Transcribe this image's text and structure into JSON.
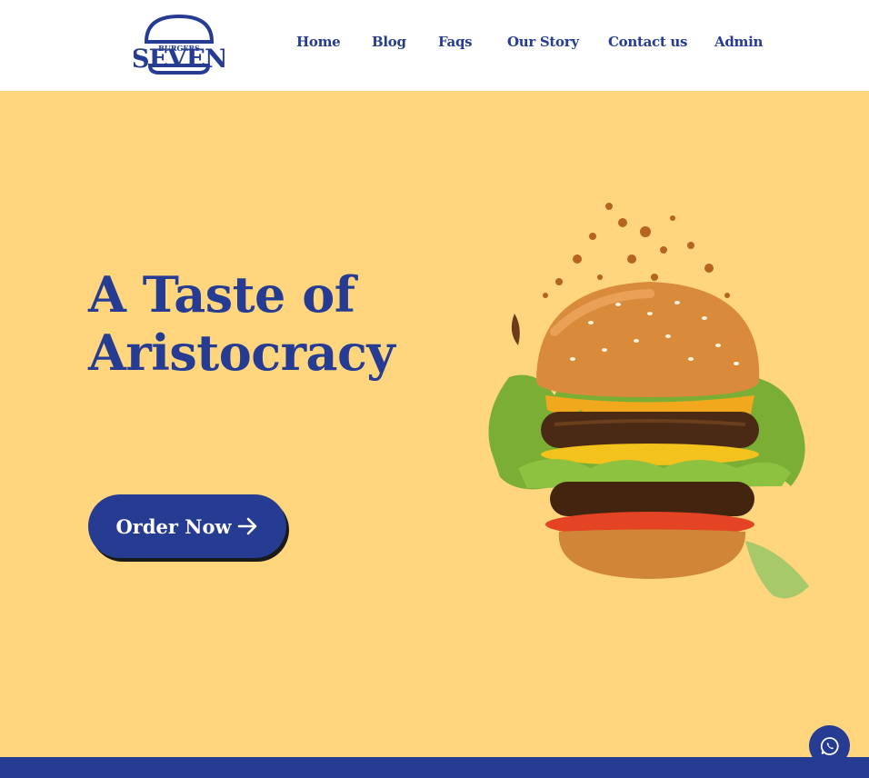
{
  "brand": {
    "logo_text": "SEVEN",
    "logo_subtext": "BURGERS",
    "color": "#263c93"
  },
  "nav": {
    "items": [
      {
        "label": "Home"
      },
      {
        "label": "Blog"
      },
      {
        "label": "Faqs"
      },
      {
        "label": "Our Story"
      },
      {
        "label": "Contact us"
      },
      {
        "label": "Admin"
      }
    ]
  },
  "hero": {
    "title_line1": "A Taste of",
    "title_line2": "Aristocracy",
    "cta_label": "Order Now",
    "cta_icon": "arrow-right-icon"
  },
  "image": {
    "subject": "burger-icon"
  },
  "floating": {
    "icon": "whatsapp-icon"
  },
  "colors": {
    "background": "#ffd57e",
    "primary": "#263c93",
    "header": "#ffffff"
  }
}
